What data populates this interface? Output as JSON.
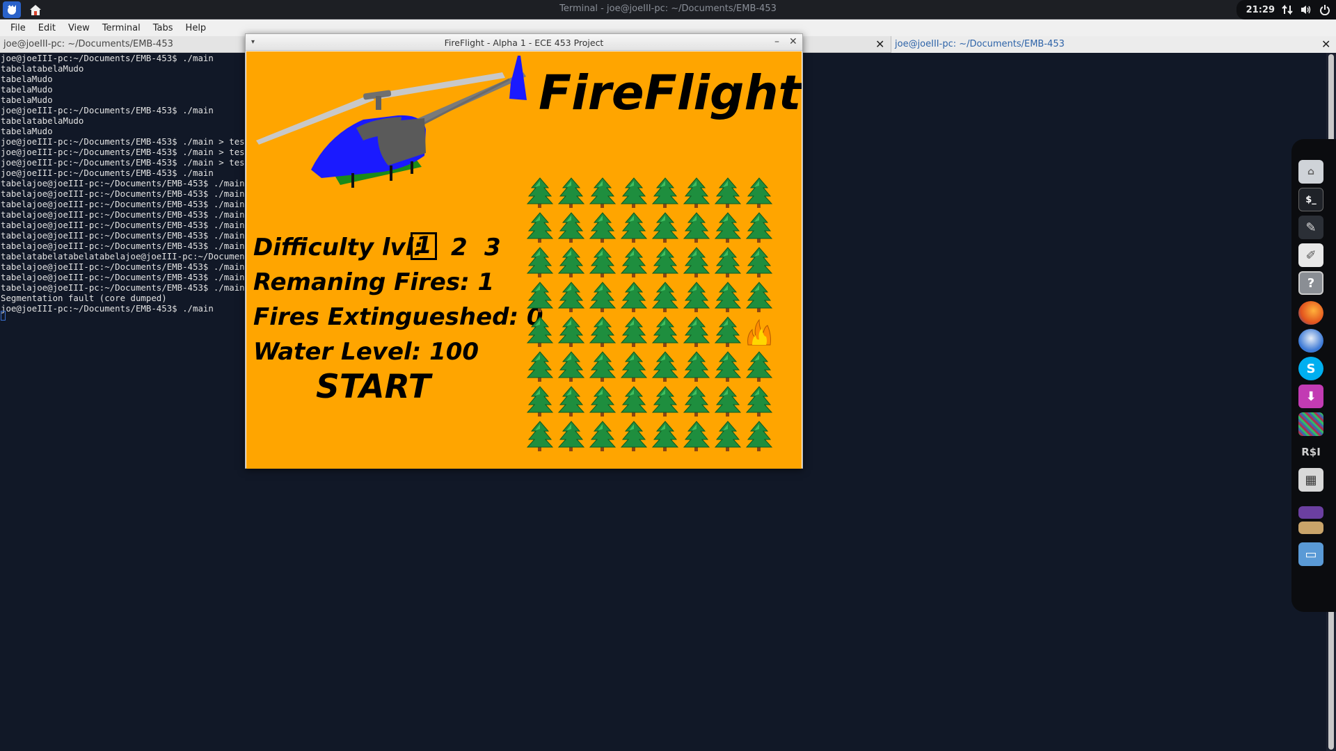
{
  "top_panel": {
    "window_title": "Terminal - joe@joeIII-pc: ~/Documents/EMB-453",
    "clock": "21:29"
  },
  "terminal": {
    "menu": [
      "File",
      "Edit",
      "View",
      "Terminal",
      "Tabs",
      "Help"
    ],
    "tabs": [
      {
        "label": "joe@joeIII-pc: ~/Documents/EMB-453"
      },
      {
        "label": "joe@joeIII-pc: ~/Documents/EMB-453"
      }
    ],
    "output": "joe@joeIII-pc:~/Documents/EMB-453$ ./main\ntabelatabelaMudo\ntabelaMudo\ntabelaMudo\ntabelaMudo\njoe@joeIII-pc:~/Documents/EMB-453$ ./main\ntabelatabelaMudo\ntabelaMudo\njoe@joeIII-pc:~/Documents/EMB-453$ ./main > teste\njoe@joeIII-pc:~/Documents/EMB-453$ ./main > teste\njoe@joeIII-pc:~/Documents/EMB-453$ ./main > teste\njoe@joeIII-pc:~/Documents/EMB-453$ ./main\ntabelajoe@joeIII-pc:~/Documents/EMB-453$ ./main\ntabelajoe@joeIII-pc:~/Documents/EMB-453$ ./main\ntabelajoe@joeIII-pc:~/Documents/EMB-453$ ./main\ntabelajoe@joeIII-pc:~/Documents/EMB-453$ ./main\ntabelajoe@joeIII-pc:~/Documents/EMB-453$ ./main\ntabelajoe@joeIII-pc:~/Documents/EMB-453$ ./main\ntabelajoe@joeIII-pc:~/Documents/EMB-453$ ./main\ntabelatabelatabelatabelajoe@joeIII-pc:~/Documents/EMB-453$ ./main\ntabelajoe@joeIII-pc:~/Documents/EMB-453$ ./main\ntabelajoe@joeIII-pc:~/Documents/EMB-453$ ./main\ntabelajoe@joeIII-pc:~/Documents/EMB-453$ ./main\nSegmentation fault (core dumped)\njoe@joeIII-pc:~/Documents/EMB-453$ ./main"
  },
  "game": {
    "window_title": "FireFlight - Alpha 1 - ECE 453 Project",
    "logo": "FireFlight",
    "difficulty_label": "Difficulty lvl:",
    "levels": [
      "1",
      "2",
      "3"
    ],
    "selected_level": "1",
    "remaining_fires": "Remaning Fires: 1",
    "fires_extinguished": "Fires Extingueshed: 0",
    "water_level": "Water Level: 100",
    "start": "START",
    "grid": {
      "rows": 8,
      "cols": 8,
      "fire_cells": [
        {
          "row": 5,
          "col": 8
        }
      ]
    },
    "colors": {
      "background": "#ffa500",
      "tree": "#1e8e3e",
      "fire": "#ffd700",
      "helicopter": "#1a1aff"
    }
  },
  "dock": {
    "icons": [
      "home-folder-icon",
      "terminal-icon",
      "text-editor-icon",
      "notes-icon",
      "help-icon",
      "firefox-icon",
      "thunderbird-icon",
      "skype-icon",
      "downloader-icon",
      "image-viewer-icon",
      "rsi-icon",
      "calculator-icon",
      "workspace-icon",
      "photo-icon",
      "display-icon"
    ]
  }
}
